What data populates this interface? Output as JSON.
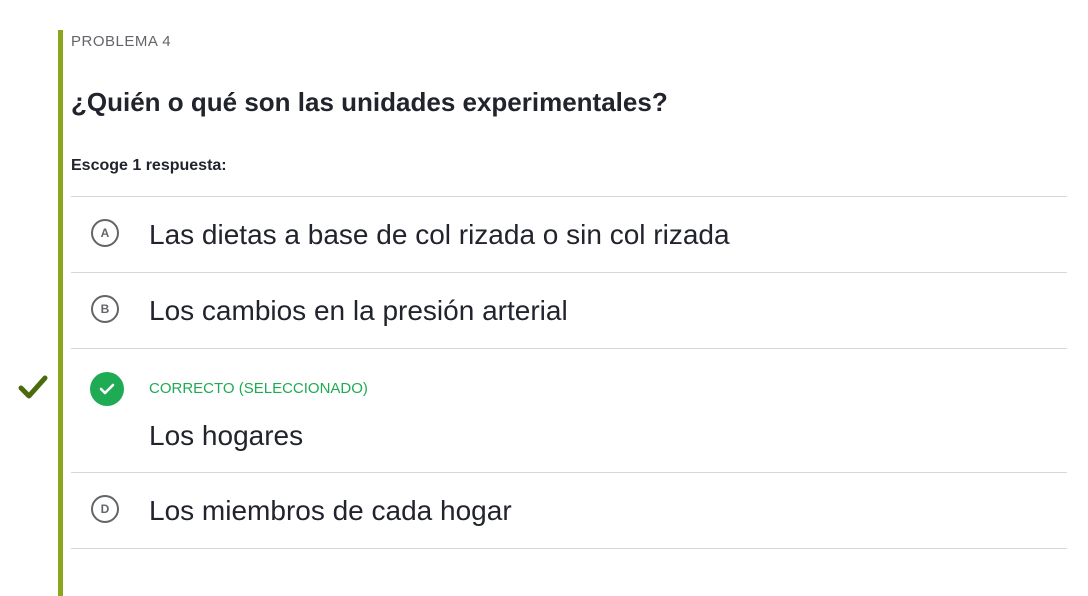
{
  "problem": {
    "label": "PROBLEMA 4",
    "question": "¿Quién o qué son las unidades experimentales?",
    "instruction": "Escoge 1 respuesta:"
  },
  "choices": [
    {
      "letter": "A",
      "text": "Las dietas a base de col rizada o sin col rizada"
    },
    {
      "letter": "B",
      "text": "Los cambios en la presión arterial"
    },
    {
      "status": "CORRECTO (SELECCIONADO)",
      "text": "Los hogares"
    },
    {
      "letter": "D",
      "text": "Los miembros de cada hogar"
    }
  ],
  "colors": {
    "accent_bar": "#8aa61c",
    "correct_green": "#1fab54",
    "check_mark": "#4b6a0c",
    "divider": "#d6d8da"
  }
}
